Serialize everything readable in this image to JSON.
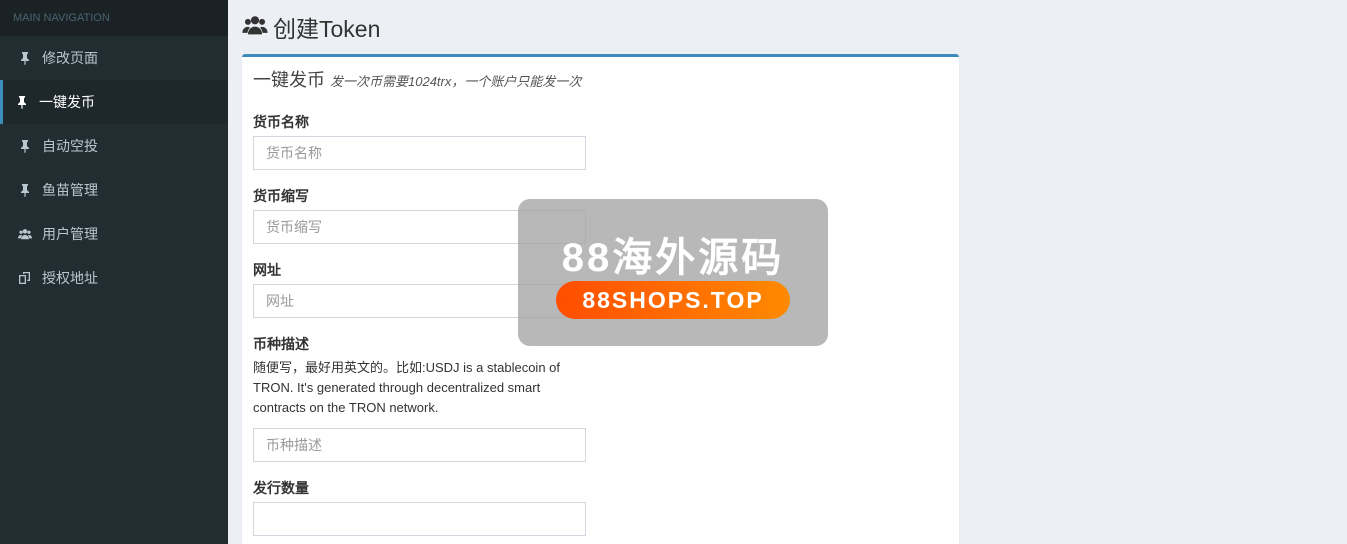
{
  "sidebar": {
    "header": "MAIN NAVIGATION",
    "items": [
      {
        "label": "修改页面",
        "icon": "pin-icon"
      },
      {
        "label": "一键发币",
        "icon": "pin-icon"
      },
      {
        "label": "自动空投",
        "icon": "pin-icon"
      },
      {
        "label": "鱼苗管理",
        "icon": "pin-icon"
      },
      {
        "label": "用户管理",
        "icon": "users-icon"
      },
      {
        "label": "授权地址",
        "icon": "copy-icon"
      }
    ]
  },
  "page": {
    "title": "创建Token",
    "icon": "users-icon"
  },
  "form": {
    "title": "一键发币",
    "subtitle": "发一次币需要1024trx，一个账户只能发一次",
    "fields": [
      {
        "label": "货币名称",
        "placeholder": "货币名称",
        "value": ""
      },
      {
        "label": "货币缩写",
        "placeholder": "货币缩写",
        "value": ""
      },
      {
        "label": "网址",
        "placeholder": "网址",
        "value": ""
      },
      {
        "label": "币种描述",
        "help": "随便写，最好用英文的。比如:USDJ is a stablecoin of TRON. It's generated through decentralized smart contracts on the TRON network.",
        "placeholder": "币种描述",
        "value": ""
      },
      {
        "label": "发行数量",
        "placeholder": "",
        "value": ""
      }
    ]
  },
  "watermark": {
    "title": "88海外源码",
    "badge": "88SHOPS.TOP"
  },
  "colors": {
    "sidebar_bg": "#222d32",
    "accent": "#3c8dbc",
    "content_bg": "#ecf0f5",
    "watermark_badge": "#ff6a00"
  }
}
